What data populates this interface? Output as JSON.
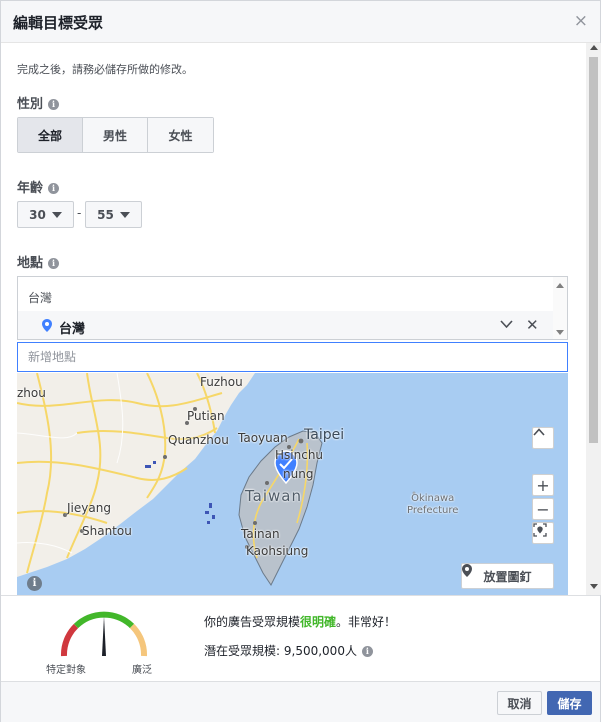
{
  "dialog": {
    "title": "編輯目標受眾",
    "close_glyph": "×"
  },
  "notice": "完成之後，請務必儲存所做的修改。",
  "gender": {
    "label": "性別",
    "options": [
      "全部",
      "男性",
      "女性"
    ],
    "selected": "全部"
  },
  "age": {
    "label": "年齡",
    "min": "30",
    "separator": "-",
    "max": "55"
  },
  "location": {
    "label": "地點",
    "group_label": "台灣",
    "selected_item": "台灣",
    "input_placeholder": "新增地點",
    "drop_pin_label": "放置圖釘"
  },
  "map": {
    "labels": {
      "fuzhou": "Fuzhou",
      "zhou": "zhou",
      "putian": "Putian",
      "quanzhou": "Quanzhou",
      "taoyuan": "Taoyuan",
      "taipei": "Taipei",
      "hsinchu": "Hsinchu",
      "taichung": "nung",
      "taiwan": "Taiwan",
      "jieyang": "Jieyang",
      "shantou": "Shantou",
      "tainan": "Tainan",
      "kaohsiung": "Kaohsiung",
      "okinawa_1": "Okinawa",
      "okinawa_2": "Prefecture"
    },
    "colors": {
      "water": "#a8ccf2",
      "land": "#f2efe9",
      "selected_region": "#b9c2cc",
      "highway": "#f6d768",
      "pin": "#4080ff"
    }
  },
  "audience": {
    "definition_prefix": "你的廣告受眾規模",
    "definition_strong": "很明確",
    "definition_suffix": "。非常好！",
    "potential_label": "潛在受眾規模:",
    "potential_value": "9,500,000人",
    "gauge_left": "特定對象",
    "gauge_right": "廣泛",
    "gauge_level": 0.5
  },
  "buttons": {
    "cancel": "取消",
    "save": "儲存"
  }
}
